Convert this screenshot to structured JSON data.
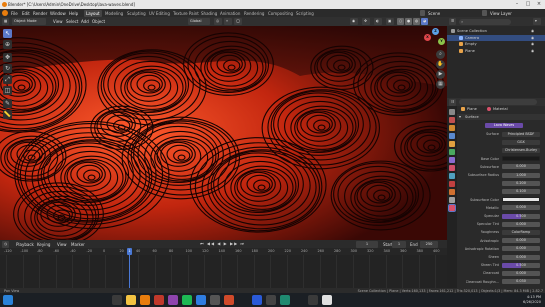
{
  "window": {
    "title": "Blender* [C:\\Users\\Admin\\OneDrive\\Desktop\\lava-waves.blend]"
  },
  "menu": [
    "File",
    "Edit",
    "Render",
    "Window",
    "Help"
  ],
  "workspaces": [
    "Layout",
    "Modeling",
    "Sculpting",
    "UV Editing",
    "Texture Paint",
    "Shading",
    "Animation",
    "Rendering",
    "Compositing",
    "Scripting"
  ],
  "active_workspace": "Layout",
  "viewport_header": {
    "mode": "Object Mode",
    "menus": [
      "View",
      "Select",
      "Add",
      "Object"
    ],
    "orientation": "Global"
  },
  "scene": {
    "scene_name": "Scene",
    "view_layer": "View Layer"
  },
  "outliner": {
    "rows": [
      {
        "label": "Scene Collection",
        "indent": 0,
        "selected": false,
        "icon_color": "#9a9a9a"
      },
      {
        "label": "Camera",
        "indent": 1,
        "selected": true,
        "icon_color": "#8ab4ff"
      },
      {
        "label": "Empty",
        "indent": 1,
        "selected": false,
        "icon_color": "#e8a34a"
      },
      {
        "label": "Plane",
        "indent": 1,
        "selected": false,
        "icon_color": "#e8a34a"
      }
    ]
  },
  "properties": {
    "breadcrumb": [
      "Plane",
      "Material"
    ],
    "panel": "Surface",
    "material_chip": "Lava Waves",
    "rows": [
      {
        "label": "Surface",
        "value": "Principled BSDF",
        "style": "dark"
      },
      {
        "label": "",
        "value": "GGX",
        "style": "dark"
      },
      {
        "label": "",
        "value": "Christensen-Burley",
        "style": "dark"
      },
      {
        "label": "Base Color",
        "value": "",
        "style": "color",
        "color": "#1a1a1a"
      },
      {
        "label": "Subsurface",
        "value": "0.000",
        "style": "num"
      },
      {
        "label": "Subsurface Radius",
        "value": "1.000",
        "style": "num"
      },
      {
        "label": "",
        "value": "0.200",
        "style": "num"
      },
      {
        "label": "",
        "value": "0.100",
        "style": "num"
      },
      {
        "label": "Subsurface Color",
        "value": "",
        "style": "color",
        "color": "#e6e6e6"
      },
      {
        "label": "Metallic",
        "value": "0.000",
        "style": "num"
      },
      {
        "label": "Specular",
        "value": "0.500",
        "style": "accent"
      },
      {
        "label": "Specular Tint",
        "value": "0.000",
        "style": "num"
      },
      {
        "label": "Roughness",
        "value": "ColorRamp",
        "style": "dark"
      },
      {
        "label": "Anisotropic",
        "value": "0.000",
        "style": "num"
      },
      {
        "label": "Anisotropic Rotation",
        "value": "0.000",
        "style": "num"
      },
      {
        "label": "Sheen",
        "value": "0.000",
        "style": "num"
      },
      {
        "label": "Sheen Tint",
        "value": "0.500",
        "style": "accent"
      },
      {
        "label": "Clearcoat",
        "value": "0.000",
        "style": "num"
      },
      {
        "label": "Clearcoat Roughn...",
        "value": "0.030",
        "style": "num"
      }
    ]
  },
  "timeline": {
    "menus": [
      "Playback",
      "Keying",
      "View",
      "Marker"
    ],
    "current_frame": "1",
    "start_label": "Start",
    "start": "1",
    "end_label": "End",
    "end": "250",
    "ruler": [
      "-120",
      "-100",
      "-80",
      "-60",
      "-40",
      "-20",
      "0",
      "20",
      "40",
      "60",
      "80",
      "100",
      "120",
      "140",
      "160",
      "180",
      "200",
      "220",
      "240",
      "260",
      "280",
      "300",
      "320",
      "340",
      "360",
      "380",
      "400"
    ]
  },
  "status": {
    "left": "Pan View",
    "right": "Scene Collection | Plane | Verts:160,133 | Faces:161,212 | Tris:320,013 | Objects:1/3 | Mem: 84.3 MiB | 2.82.7"
  },
  "taskbar": {
    "time": "4:13 PM",
    "date": "6/26/2020"
  },
  "colors": {
    "accent": "#4a78d4",
    "slider_accent": "#6a4aa8",
    "lava_bright": "#e23a1e",
    "lava_dark": "#1c0604"
  },
  "icons": [
    "blender-logo-icon",
    "cursor-icon",
    "move-icon",
    "rotate-icon",
    "scale-icon",
    "transform-icon",
    "annotate-icon",
    "measure-icon",
    "zoom-icon",
    "hand-icon",
    "camera-icon",
    "grid-icon",
    "play-icon",
    "windows-start-icon",
    "search-icon"
  ]
}
